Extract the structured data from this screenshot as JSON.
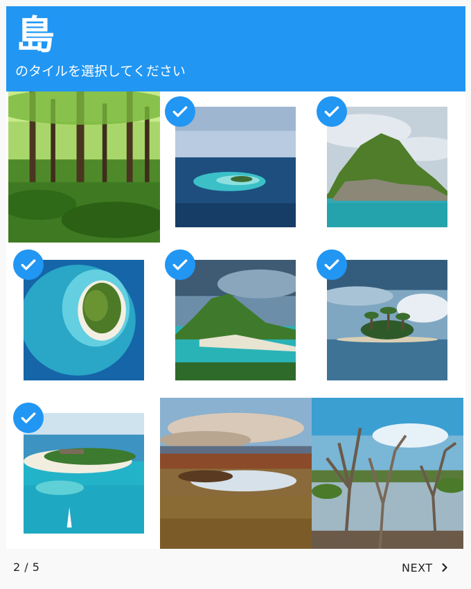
{
  "header": {
    "keyword": "島",
    "instruction": "のタイルを選択してください",
    "color": "#2196f3"
  },
  "tiles": [
    {
      "icon": "forest-image",
      "selected": false
    },
    {
      "icon": "atoll-island-image",
      "selected": true
    },
    {
      "icon": "rocky-island-image",
      "selected": true
    },
    {
      "icon": "round-island-aerial-image",
      "selected": true
    },
    {
      "icon": "green-hill-island-image",
      "selected": true
    },
    {
      "icon": "palm-island-image",
      "selected": true
    },
    {
      "icon": "resort-island-image",
      "selected": true
    },
    {
      "icon": "marsh-landscape-image",
      "selected": false
    },
    {
      "icon": "mangrove-trees-image",
      "selected": false
    }
  ],
  "footer": {
    "page_indicator": "2 / 5",
    "next_label": "NEXT",
    "next_icon": "chevron-right-icon"
  }
}
